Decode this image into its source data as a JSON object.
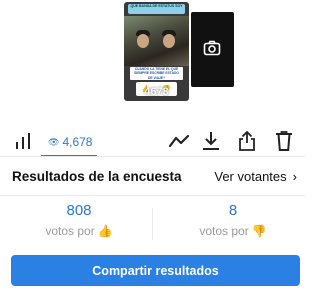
{
  "story": {
    "banner_text": "QUE BANDA DE ESTATUS SOY",
    "caption": "CUANDO LA TIENE EL QUE SIEMPRE ESCRIBE ESTADO DE VIAJE?",
    "poll_options": [
      "👍",
      "👎"
    ],
    "view_count": "4678"
  },
  "toolbar": {
    "views": "4,678",
    "eye_glyph": "👁"
  },
  "poll": {
    "title": "Resultados de la encuesta",
    "see_voters": "Ver votantes",
    "chevron": "›",
    "results": [
      {
        "count": "808",
        "label": "votos por",
        "emoji": "👍"
      },
      {
        "count": "8",
        "label": "votos por",
        "emoji": "👎"
      }
    ]
  },
  "actions": {
    "share_results": "Compartir resultados"
  },
  "colors": {
    "accent": "#2a78d6",
    "button": "#2b80e3"
  }
}
